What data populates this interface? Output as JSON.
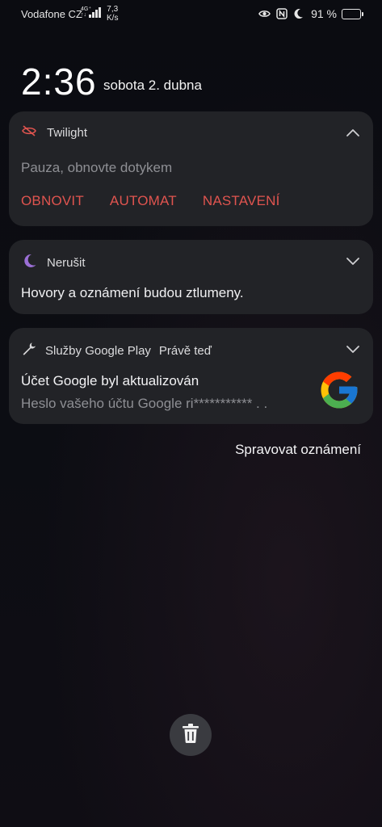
{
  "status_bar": {
    "carrier": "Vodafone CZ",
    "network_badge_top": "4G⁺",
    "network_badge_bottom": "↑↓",
    "speed_value": "7,3",
    "speed_unit": "K/s",
    "battery_percent": "91 %",
    "battery_level": 0.91,
    "icons": [
      "eye-icon",
      "nfc-icon",
      "moon-icon",
      "battery-icon"
    ]
  },
  "lockscreen": {
    "time": "2:36",
    "date": "sobota 2. dubna"
  },
  "notifications": {
    "twilight": {
      "app_name": "Twilight",
      "icon": "eye-off-icon",
      "body": "Pauza, obnovte dotykem",
      "actions": [
        "OBNOVIT",
        "AUTOMAT",
        "NASTAVENÍ"
      ],
      "accent_color": "#e0544f",
      "expanded": true
    },
    "dnd": {
      "app_name": "Nerušit",
      "icon": "moon-icon",
      "body": "Hovory a oznámení budou ztlumeny.",
      "icon_color": "#9b6fd6"
    },
    "google_play": {
      "app_name": "Služby Google Play",
      "time": "Právě teď",
      "icon": "wrench-icon",
      "title": "Účet Google byl aktualizován",
      "text": "Heslo vašeho účtu Google ri*********** . .",
      "large_icon": "google-logo"
    }
  },
  "manage_label": "Spravovat oznámení",
  "clear_all_icon": "trash-icon"
}
